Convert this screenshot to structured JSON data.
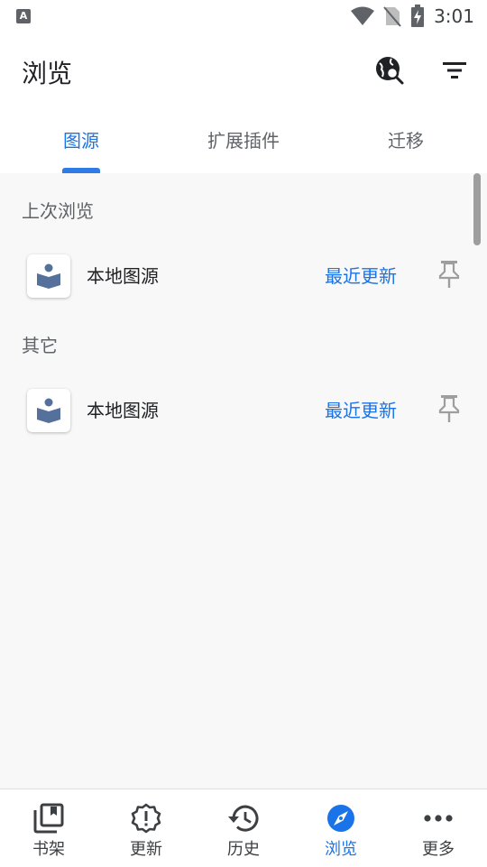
{
  "status_bar": {
    "notification_letter": "A",
    "time": "3:01"
  },
  "app_bar": {
    "title": "浏览",
    "actions": [
      "globe-search-icon",
      "filter-icon"
    ]
  },
  "tabs": [
    {
      "label": "图源",
      "active": true
    },
    {
      "label": "扩展插件",
      "active": false
    },
    {
      "label": "迁移",
      "active": false
    }
  ],
  "sections": [
    {
      "header": "上次浏览",
      "items": [
        {
          "name": "本地图源",
          "latest_label": "最近更新"
        }
      ]
    },
    {
      "header": "其它",
      "items": [
        {
          "name": "本地图源",
          "latest_label": "最近更新"
        }
      ]
    }
  ],
  "bottom_nav": [
    {
      "label": "书架",
      "icon": "bookshelf-icon",
      "active": false
    },
    {
      "label": "更新",
      "icon": "alert-badge-icon",
      "active": false
    },
    {
      "label": "历史",
      "icon": "history-icon",
      "active": false
    },
    {
      "label": "浏览",
      "icon": "compass-icon",
      "active": true
    },
    {
      "label": "更多",
      "icon": "more-icon",
      "active": false
    }
  ],
  "colors": {
    "accent": "#1a73e8",
    "content_background": "#f8f8f8",
    "source_icon": "#55719b"
  }
}
